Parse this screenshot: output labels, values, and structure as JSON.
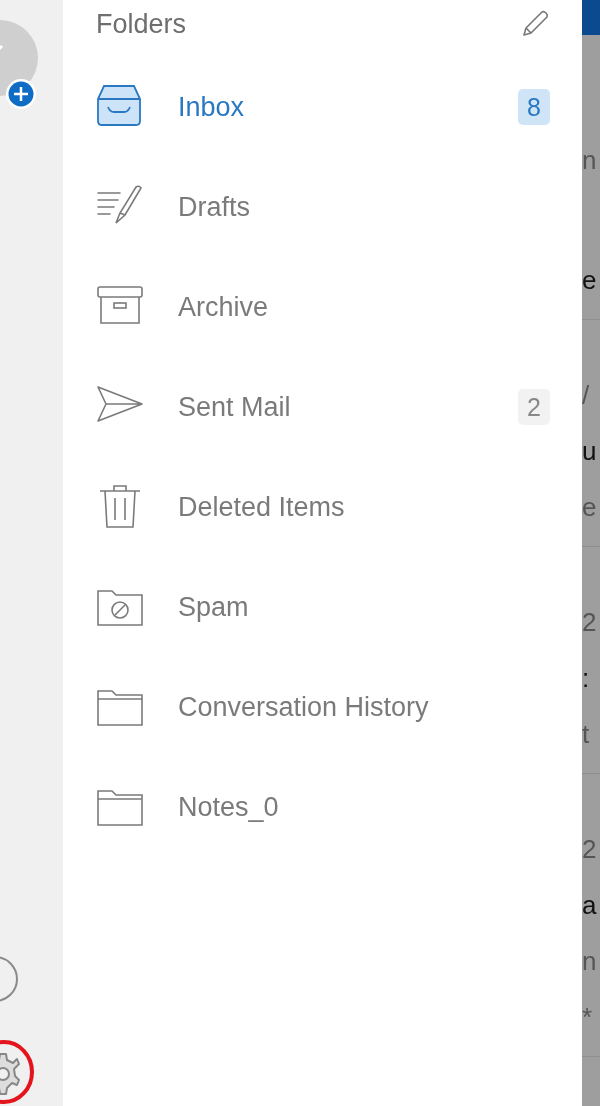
{
  "drawer": {
    "title": "Folders",
    "folders": [
      {
        "name": "Inbox",
        "kind": "inbox",
        "selected": true,
        "count": "8"
      },
      {
        "name": "Drafts",
        "kind": "drafts",
        "selected": false
      },
      {
        "name": "Archive",
        "kind": "archive",
        "selected": false
      },
      {
        "name": "Sent Mail",
        "kind": "sent",
        "selected": false,
        "count": "2"
      },
      {
        "name": "Deleted Items",
        "kind": "trash",
        "selected": false
      },
      {
        "name": "Spam",
        "kind": "spam",
        "selected": false
      },
      {
        "name": "Conversation History",
        "kind": "folder",
        "selected": false
      },
      {
        "name": "Notes_0",
        "kind": "folder",
        "selected": false
      }
    ]
  },
  "message_list": {
    "rows": [
      {
        "lines": [
          "n",
          "e"
        ]
      },
      {
        "lines": [
          "/",
          "u",
          "e"
        ]
      },
      {
        "lines": [
          "2",
          ":",
          "t"
        ]
      },
      {
        "lines": [
          "2",
          "a",
          "n",
          "*"
        ]
      }
    ]
  }
}
